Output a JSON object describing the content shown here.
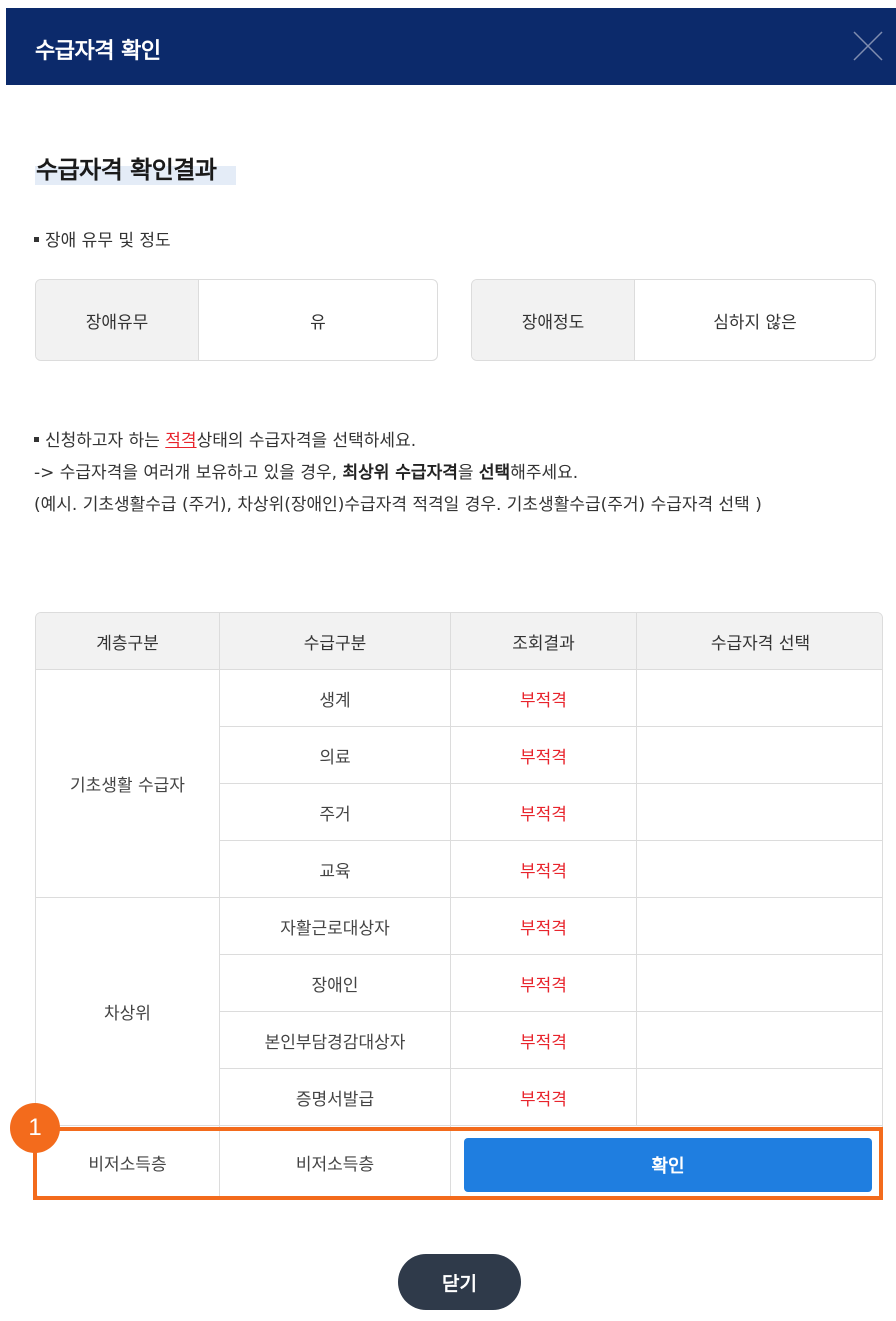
{
  "dialog": {
    "title": "수급자격 확인",
    "close_icon": "close-icon"
  },
  "section": {
    "title": "수급자격 확인결과"
  },
  "disability": {
    "heading": "장애 유무 및 정도",
    "presence_label": "장애유무",
    "presence_value": "유",
    "degree_label": "장애정도",
    "degree_value": "심하지 않은"
  },
  "notice": {
    "line1_a": "신청하고자 하는 ",
    "line1_red": "적격",
    "line1_b": "상태의 수급자격을 선택하세요.",
    "line2_a": "-> 수급자격을 여러개 보유하고 있을 경우, ",
    "line2_bold1": "최상위 수급자격",
    "line2_b": "을 ",
    "line2_bold2": "선택",
    "line2_c": "해주세요.",
    "line3": "(예시. 기초생활수급 (주거), 차상위(장애인)수급자격 적격일 경우. 기초생활수급(주거) 수급자격 선택 )"
  },
  "table": {
    "headers": [
      "계층구분",
      "수급구분",
      "조회결과",
      "수급자격 선택"
    ],
    "groups": [
      {
        "name": "기초생활 수급자",
        "rows": [
          {
            "type": "생계",
            "result": "부적격"
          },
          {
            "type": "의료",
            "result": "부적격"
          },
          {
            "type": "주거",
            "result": "부적격"
          },
          {
            "type": "교육",
            "result": "부적격"
          }
        ]
      },
      {
        "name": "차상위",
        "rows": [
          {
            "type": "자활근로대상자",
            "result": "부적격"
          },
          {
            "type": "장애인",
            "result": "부적격"
          },
          {
            "type": "본인부담경감대상자",
            "result": "부적격"
          },
          {
            "type": "증명서발급",
            "result": "부적격"
          }
        ]
      }
    ],
    "last_row": {
      "group": "비저소득층",
      "type": "비저소득층",
      "button_label": "확인"
    }
  },
  "annotation": {
    "badge_number": "1",
    "color": "#f36b1c"
  },
  "footer": {
    "close_label": "닫기"
  },
  "colors": {
    "header_bg": "#0c2a6b",
    "accent_blue": "#1f7ee0",
    "error_red": "#e8242c",
    "close_button_bg": "#2f3a4a"
  }
}
